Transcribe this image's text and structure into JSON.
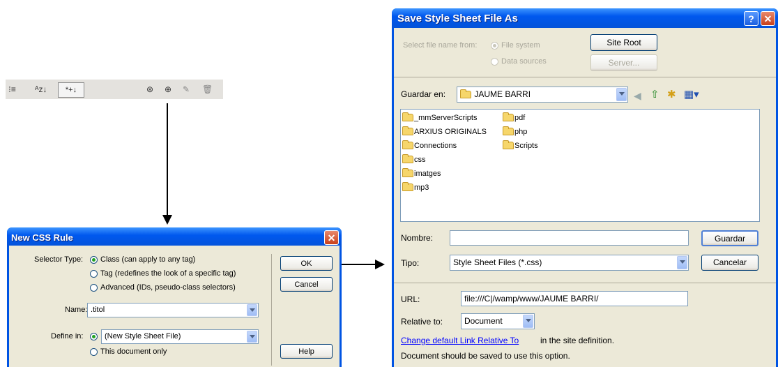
{
  "toolbar": {
    "btn_show_category": "⁝≡",
    "btn_sort_az": "ᴬz↓",
    "btn_show_set": "*+↓",
    "icon_link": "⊛",
    "icon_new_rule": "⊕",
    "icon_edit": "✎",
    "icon_delete": "🗑"
  },
  "new_css_rule": {
    "title": "New CSS Rule",
    "selector_type_label": "Selector Type:",
    "selector_options": [
      "Class (can apply to any tag)",
      "Tag (redefines the look of a specific tag)",
      "Advanced (IDs, pseudo-class selectors)"
    ],
    "selector_selected": 0,
    "name_label": "Name:",
    "name_value": ".titol",
    "define_in_label": "Define in:",
    "define_in_value": "(New Style Sheet File)",
    "define_in_alt": "This document only",
    "ok_label": "OK",
    "cancel_label": "Cancel",
    "help_label": "Help"
  },
  "save_dialog": {
    "title": "Save Style Sheet File As",
    "select_from_label": "Select file name from:",
    "opt_file_system": "File system",
    "opt_data_sources": "Data sources",
    "site_root_label": "Site Root",
    "server_label": "Server...",
    "look_in_label": "Guardar en:",
    "look_in_value": "JAUME BARRI",
    "files_col1": [
      "_mmServerScripts",
      "ARXIUS ORIGINALS",
      "Connections",
      "css",
      "imatges",
      "mp3"
    ],
    "files_col2": [
      "pdf",
      "php",
      "Scripts"
    ],
    "filename_label": "Nombre:",
    "filename_value": "",
    "save_label": "Guardar",
    "filetype_label": "Tipo:",
    "filetype_value": "Style Sheet Files (*.css)",
    "cancel_label": "Cancelar",
    "url_label": "URL:",
    "url_value": "file:///C|/wamp/www/JAUME BARRI/",
    "relative_to_label": "Relative to:",
    "relative_to_value": "Document",
    "change_link": "Change default Link Relative To",
    "change_link_suffix": "in the site definition.",
    "note": "Document should be saved to use this option."
  },
  "colors": {
    "title_bar": "#0058ee",
    "dialog_bg": "#ece9d8",
    "close_button": "#c8401a",
    "link": "#0000ff"
  }
}
